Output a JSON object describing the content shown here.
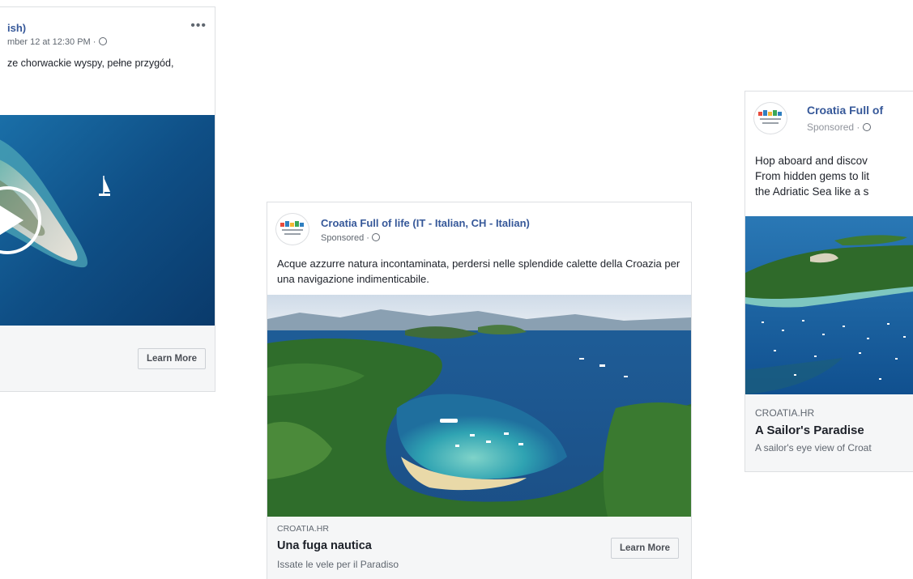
{
  "colors": {
    "link": "#365899",
    "text": "#1d2129",
    "meta": "#606770",
    "footer": "#f5f6f7",
    "border": "#dddfe2"
  },
  "card1": {
    "page_name": "ish)",
    "meta": "mber 12 at 12:30 PM ·",
    "text": "ze chorwackie wyspy, pełne przygód,",
    "more_label": "•••",
    "cta": "Learn More",
    "privacy_icon": "globe-icon",
    "media_icon": "play-icon"
  },
  "card2": {
    "page_name": "Croatia Full of life (IT - Italian, CH - Italian)",
    "meta": "Sponsored ·",
    "text": "Acque azzurre natura incontaminata, perdersi nelle splendide calette della Croazia per una navigazione indimenticabile.",
    "domain": "CROATIA.HR",
    "headline": "Una fuga nautica",
    "description": "Issate le vele per il Paradiso",
    "cta": "Learn More",
    "privacy_icon": "globe-icon"
  },
  "card3": {
    "page_name": "Croatia Full of",
    "meta": "Sponsored ·",
    "text_lines": [
      "Hop aboard and discov",
      "From hidden gems to lit",
      "the Adriatic Sea like a s"
    ],
    "domain": "CROATIA.HR",
    "headline": "A Sailor's Paradise",
    "description": "A sailor's eye view of Croat",
    "privacy_icon": "globe-icon"
  }
}
